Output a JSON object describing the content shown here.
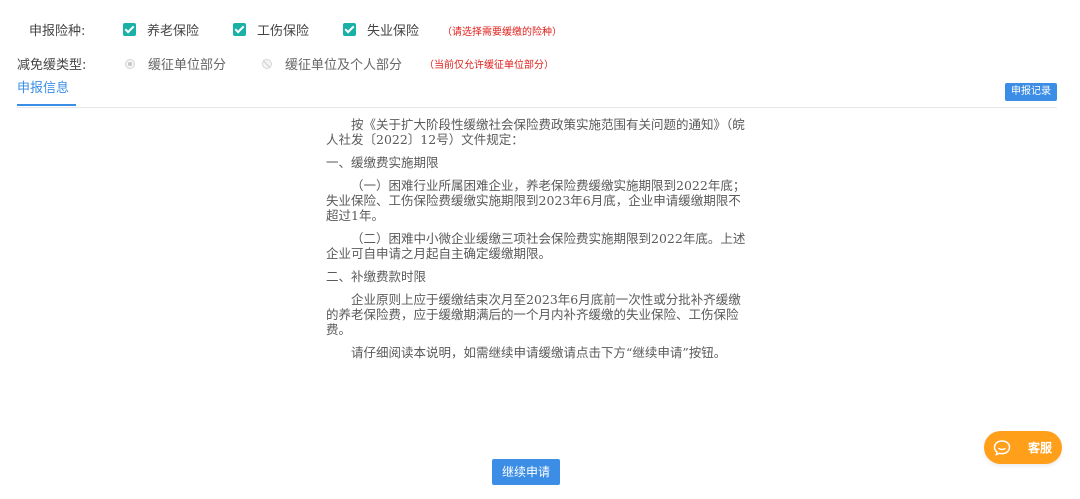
{
  "form": {
    "insurance_label": "申报险种:",
    "insurance_options": [
      {
        "label": "养老保险",
        "checked": true
      },
      {
        "label": "工伤保险",
        "checked": true
      },
      {
        "label": "失业保险",
        "checked": true
      }
    ],
    "insurance_hint": "（请选择需要缓缴的险种）",
    "type_label": "减免缓类型:",
    "type_options": [
      {
        "label": "缓征单位部分",
        "selected": true,
        "disabled": false
      },
      {
        "label": "缓征单位及个人部分",
        "selected": false,
        "disabled": true
      }
    ],
    "type_hint": "（当前仅允许缓征单位部分）"
  },
  "tabs": {
    "active_label": "申报信息",
    "record_button": "申报记录"
  },
  "notice": {
    "paragraphs": [
      "按《关于扩大阶段性缓缴社会保险费政策实施范围有关问题的通知》（皖人社发〔2022〕12号）文件规定：",
      "一、缓缴费实施期限",
      "（一）困难行业所属困难企业，养老保险费缓缴实施期限到2022年底；失业保险、工伤保险费缓缴实施期限到2023年6月底，企业申请缓缴期限不超过1年。",
      "（二）困难中小微企业缓缴三项社会保险费实施期限到2022年底。上述企业可自申请之月起自主确定缓缴期限。",
      "二、补缴费款时限",
      "企业原则上应于缓缴结束次月至2023年6月底前一次性或分批补齐缓缴的养老保险费，应于缓缴期满后的一个月内补齐缓缴的失业保险、工伤保险费。",
      "请仔细阅读本说明，如需继续申请缓缴请点击下方“继续申请”按钮。"
    ]
  },
  "actions": {
    "continue_button": "继续申请"
  },
  "service": {
    "label": "客服",
    "icon": "chat-bubble-icon"
  },
  "colors": {
    "accent": "#3b8de6",
    "checkbox": "#19b0a6",
    "hint": "#e0201c",
    "service": "#ff9f1a"
  }
}
